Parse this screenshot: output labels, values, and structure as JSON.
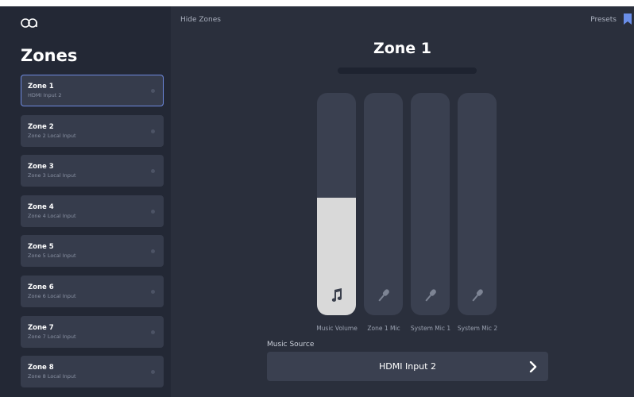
{
  "colors": {
    "background": "#2a2f3c",
    "sidebar": "#232835",
    "card": "#363c4c",
    "active_border": "#6e8ae0",
    "fader_track": "#3a4050",
    "fader_fill": "#d9d9d9",
    "accent": "#6a8ee8"
  },
  "app": {
    "logo_icon": "logo-icon"
  },
  "sidebar": {
    "title": "Zones",
    "zones": [
      {
        "name": "Zone 1",
        "source": "HDMI Input 2",
        "active": true
      },
      {
        "name": "Zone 2",
        "source": "Zone 2 Local Input",
        "active": false
      },
      {
        "name": "Zone 3",
        "source": "Zone 3 Local Input",
        "active": false
      },
      {
        "name": "Zone 4",
        "source": "Zone 4 Local Input",
        "active": false
      },
      {
        "name": "Zone 5",
        "source": "Zone 5 Local Input",
        "active": false
      },
      {
        "name": "Zone 6",
        "source": "Zone 6 Local Input",
        "active": false
      },
      {
        "name": "Zone 7",
        "source": "Zone 7 Local Input",
        "active": false
      },
      {
        "name": "Zone 8",
        "source": "Zone 8 Local Input",
        "active": false
      }
    ]
  },
  "header": {
    "hide_zones": "Hide Zones",
    "presets": "Presets",
    "presets_icon": "bookmark-icon"
  },
  "main": {
    "zone_title": "Zone 1",
    "faders": [
      {
        "label": "Music Volume",
        "icon": "music-note-icon",
        "level": 0.53
      },
      {
        "label": "Zone 1 Mic",
        "icon": "microphone-icon",
        "level": 0
      },
      {
        "label": "System Mic 1",
        "icon": "microphone-icon",
        "level": 0
      },
      {
        "label": "System Mic 2",
        "icon": "microphone-icon",
        "level": 0
      }
    ],
    "music_source_label": "Music Source",
    "music_source_value": "HDMI Input 2",
    "music_source_icon": "chevron-right-icon"
  }
}
